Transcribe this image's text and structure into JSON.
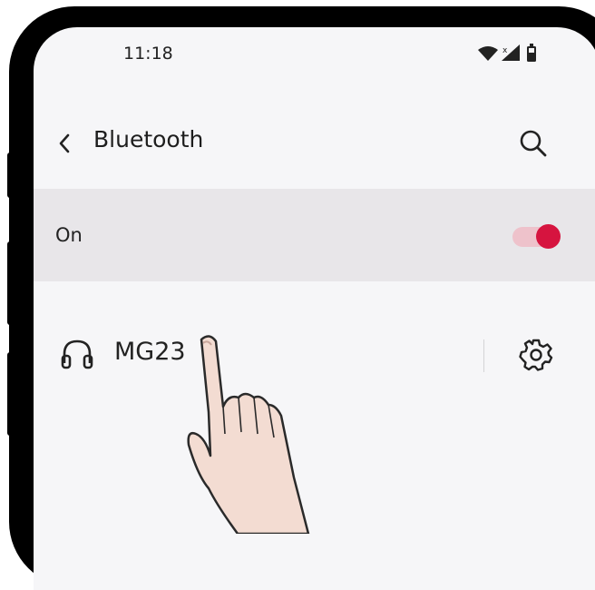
{
  "status_bar": {
    "time": "11:18",
    "icons": [
      "wifi-icon",
      "signal-icon",
      "battery-icon"
    ]
  },
  "header": {
    "back_icon": "chevron-left-icon",
    "title": "Bluetooth",
    "search_icon": "search-icon"
  },
  "bluetooth_toggle": {
    "label": "On",
    "state": "on",
    "accent_color": "#d6143f",
    "track_color": "#eec2cb"
  },
  "paired_device": {
    "icon": "headphones-icon",
    "name": "MG23",
    "settings_icon": "gear-icon"
  },
  "overlay": {
    "icon": "pointing-hand"
  }
}
